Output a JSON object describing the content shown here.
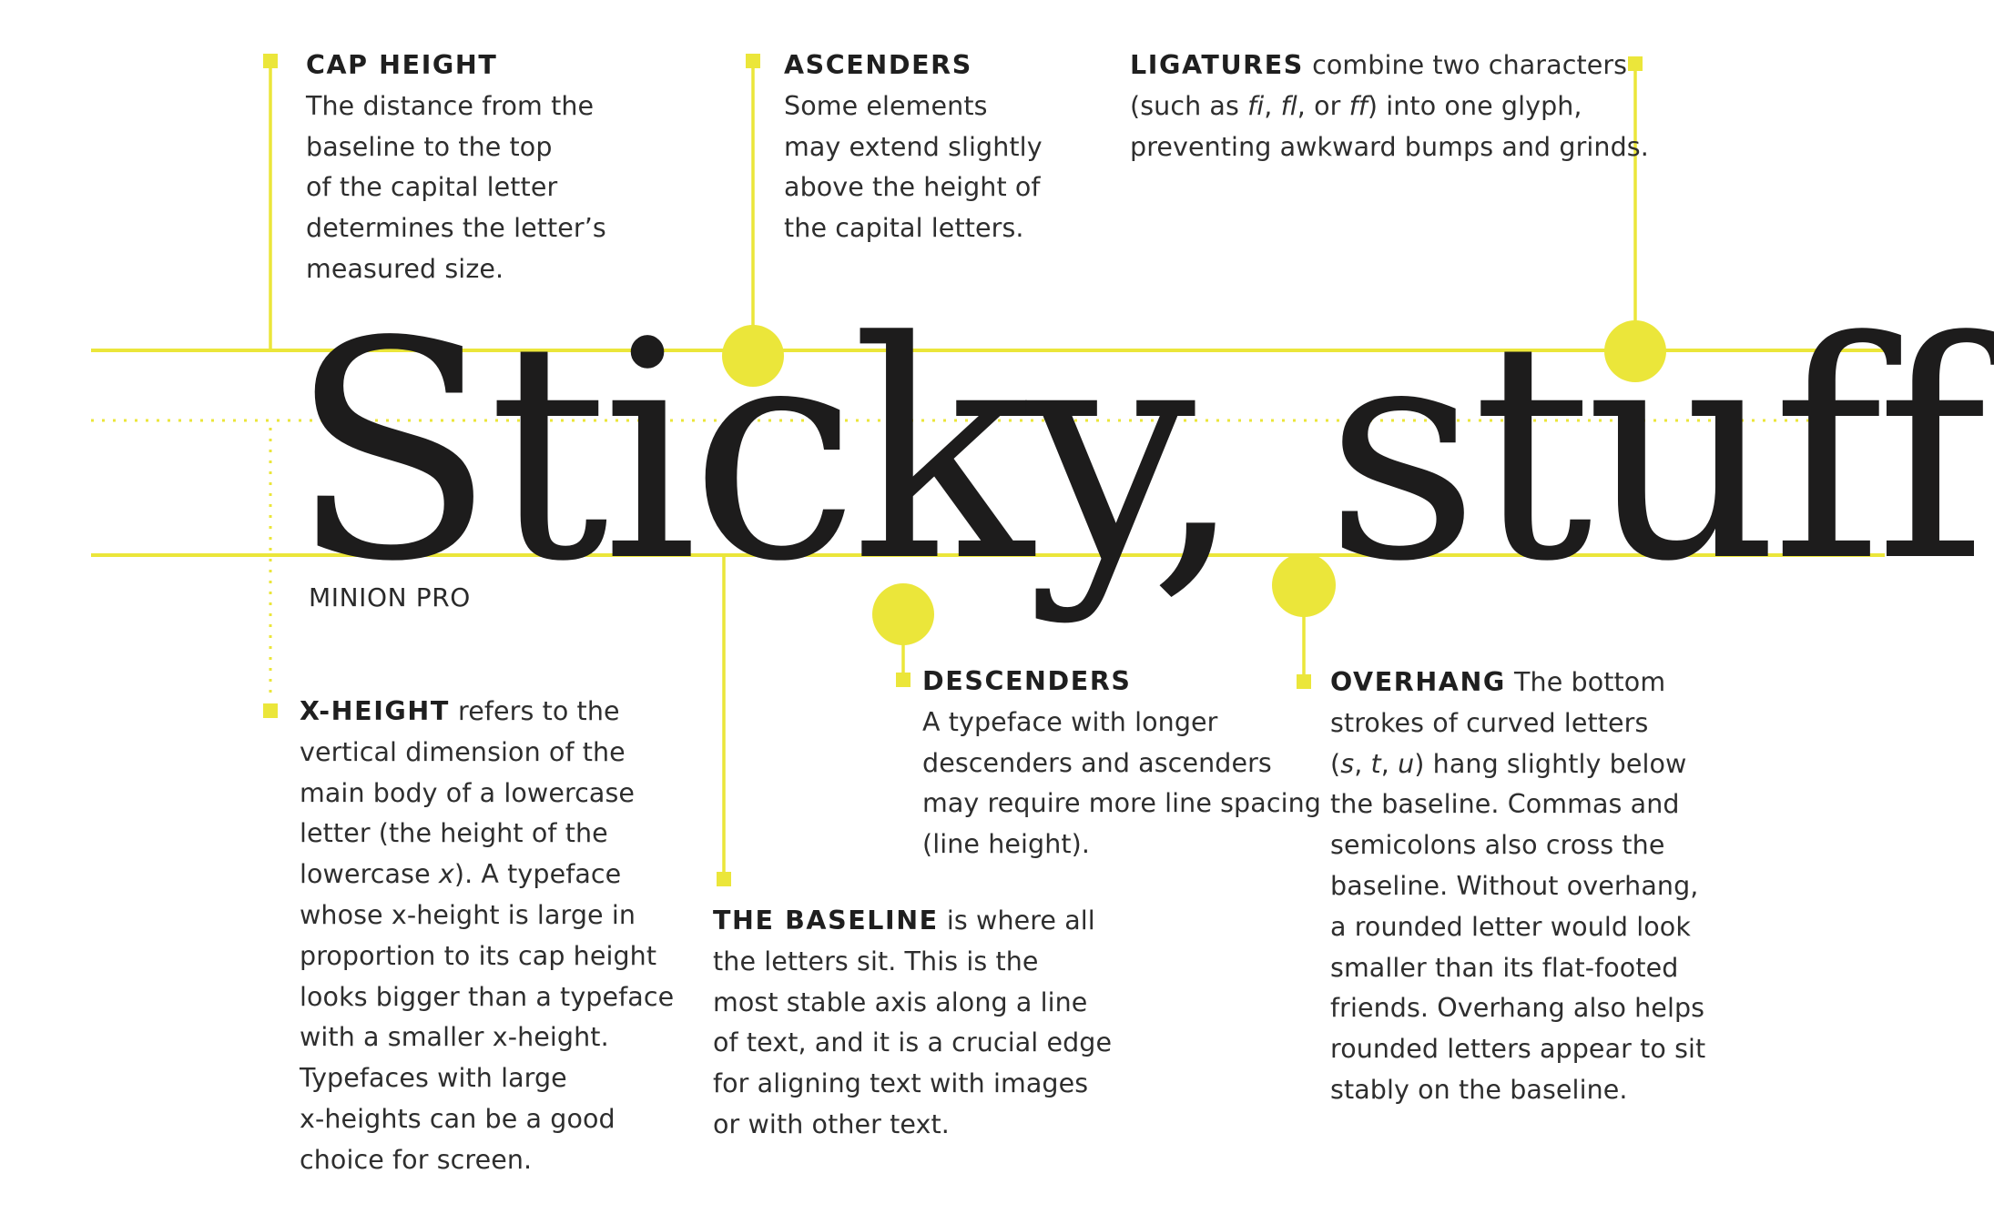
{
  "display_text": "Sticky, stuff",
  "font_name": "MINION PRO",
  "accent_color": "#ebe63a",
  "text_color": "#2e2e2e",
  "annotations": {
    "cap_height": {
      "head": "CAP HEIGHT",
      "lines": [
        "The distance from the",
        "baseline to the top",
        "of the capital letter",
        "determines the letter’s",
        "measured size."
      ]
    },
    "ascenders": {
      "head": "ASCENDERS",
      "lines": [
        "Some elements",
        "may extend slightly",
        "above the height of",
        "the capital letters."
      ]
    },
    "ligatures": {
      "head": "LIGATURES",
      "line1_rest": " combine two characters",
      "line2_a": "(such as ",
      "ex1": "fi",
      "sep1": ", ",
      "ex2": "fl",
      "sep2": ", or ",
      "ex3": "ff",
      "line2_b": ") into one glyph,",
      "line3": "preventing awkward bumps and grinds."
    },
    "x_height": {
      "head": "X-HEIGHT",
      "line1_rest": " refers to the",
      "line2": "vertical dimension of the",
      "line3": "main body of a lowercase",
      "line4": "letter (the height of the",
      "line5_a": "lowercase ",
      "line5_i": "x",
      "line5_b": "). A typeface",
      "lines_after": [
        "whose x-height is large in",
        "proportion to its cap height",
        "looks bigger than a typeface",
        "with a smaller x-height.",
        "Typefaces with large",
        "x-heights can be a good",
        "choice for screen."
      ]
    },
    "baseline": {
      "head": "THE BASELINE",
      "line1_rest": " is where all",
      "lines": [
        "the letters sit. This is the",
        "most stable axis along a line",
        "of text, and it is a crucial edge",
        "for aligning text with images",
        "or with other text."
      ]
    },
    "descenders": {
      "head": "DESCENDERS",
      "lines": [
        "A typeface with longer",
        "descenders and ascenders",
        "may require more line spacing",
        "(line height)."
      ]
    },
    "overhang": {
      "head": "OVERHANG",
      "line1_rest": " The bottom",
      "line2": "strokes of curved letters",
      "line3_a": "(",
      "s": "s",
      "c1": ", ",
      "t": "t",
      "c2": ", ",
      "u": "u",
      "line3_b": ") hang slightly below",
      "lines_after": [
        "the baseline. Commas and",
        "semicolons also cross the",
        "baseline. Without overhang,",
        "a rounded letter would look",
        "smaller than its flat-footed",
        "friends. Overhang also helps",
        "rounded letters appear to sit",
        "stably on the baseline."
      ]
    }
  }
}
